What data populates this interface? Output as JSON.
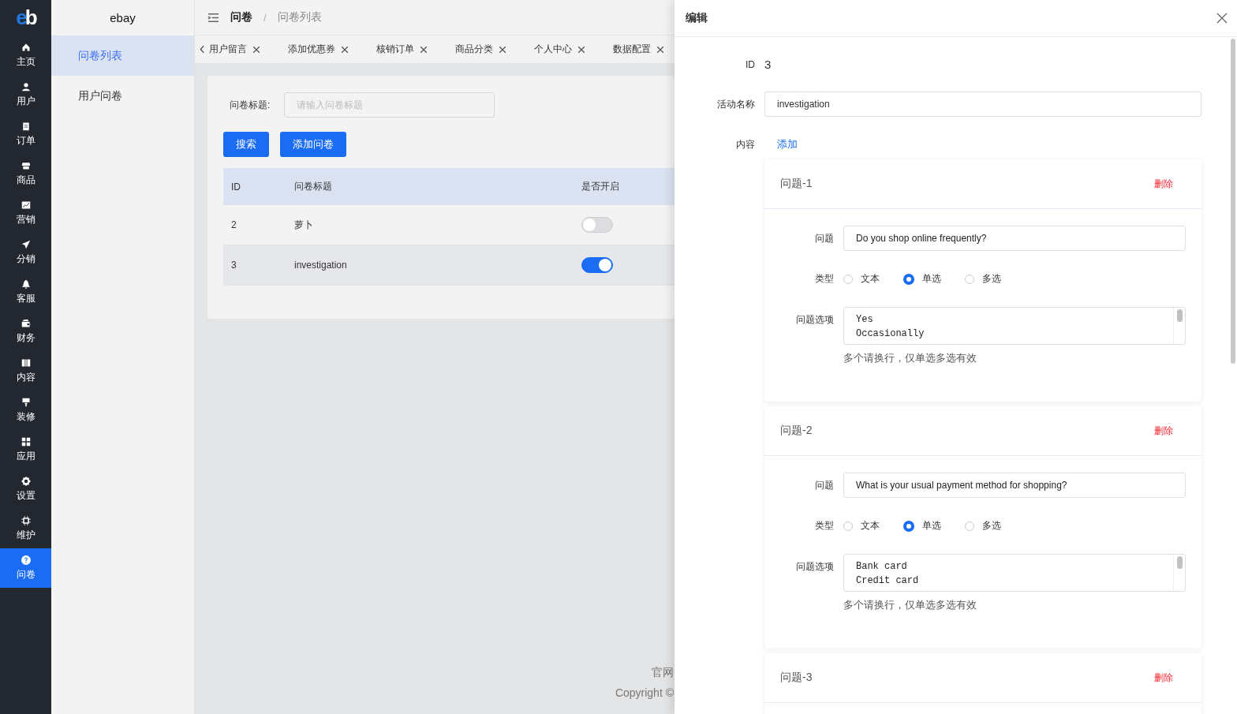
{
  "rail": {
    "logo": "eb",
    "items": [
      {
        "label": "主页",
        "kind": "home",
        "selected": false
      },
      {
        "label": "用户",
        "kind": "user",
        "selected": false
      },
      {
        "label": "订单",
        "kind": "clipboard",
        "selected": false
      },
      {
        "label": "商品",
        "kind": "shop",
        "selected": false
      },
      {
        "label": "营销",
        "kind": "chart",
        "selected": false
      },
      {
        "label": "分销",
        "kind": "plane",
        "selected": false
      },
      {
        "label": "客服",
        "kind": "bell",
        "selected": false
      },
      {
        "label": "财务",
        "kind": "wallet",
        "selected": false
      },
      {
        "label": "内容",
        "kind": "book",
        "selected": false
      },
      {
        "label": "装修",
        "kind": "brush",
        "selected": false
      },
      {
        "label": "应用",
        "kind": "grid",
        "selected": false
      },
      {
        "label": "设置",
        "kind": "gear",
        "selected": false
      },
      {
        "label": "维护",
        "kind": "chip",
        "selected": false
      },
      {
        "label": "问卷",
        "kind": "question",
        "selected": true
      }
    ]
  },
  "submenu": {
    "title": "ebay",
    "items": [
      {
        "label": "问卷列表",
        "selected": true
      },
      {
        "label": "用户问卷",
        "selected": false
      }
    ]
  },
  "breadcrumb": {
    "items": [
      "问卷",
      "问卷列表"
    ],
    "separator": "/"
  },
  "tabs": [
    {
      "label": "用户留言"
    },
    {
      "label": "添加优惠券"
    },
    {
      "label": "核销订单"
    },
    {
      "label": "商品分类"
    },
    {
      "label": "个人中心"
    },
    {
      "label": "数据配置"
    }
  ],
  "search": {
    "label": "问卷标题:",
    "placeholder": "请输入问卷标题"
  },
  "buttons": [
    "搜索",
    "添加问卷"
  ],
  "table": {
    "columns": [
      "ID",
      "问卷标题",
      "是否开启"
    ],
    "rows": [
      {
        "id": "2",
        "title": "萝卜",
        "enabled": false,
        "highlighted": false
      },
      {
        "id": "3",
        "title": "investigation",
        "enabled": true,
        "highlighted": true
      }
    ]
  },
  "footer": [
    "官网",
    "Copyright ©"
  ],
  "drawer": {
    "title": "编辑",
    "fields": [
      {
        "kind": "text",
        "label": "ID",
        "value": "3"
      },
      {
        "kind": "input",
        "label": "活动名称",
        "value": "investigation"
      },
      {
        "kind": "link",
        "label": "内容",
        "value": "添加"
      }
    ],
    "questions": [
      {
        "title": "问题-1",
        "delete": "删除",
        "question_label": "问题",
        "question": "Do you shop online frequently?",
        "type_label": "类型",
        "types": [
          {
            "label": "文本",
            "selected": false
          },
          {
            "label": "单选",
            "selected": true
          },
          {
            "label": "多选",
            "selected": false
          }
        ],
        "options_label": "问题选项",
        "options": "Yes\nOccasionally",
        "hint": "多个请换行，仅单选多选有效"
      },
      {
        "title": "问题-2",
        "delete": "删除",
        "question_label": "问题",
        "question": "What is your usual payment method for shopping?",
        "type_label": "类型",
        "types": [
          {
            "label": "文本",
            "selected": false
          },
          {
            "label": "单选",
            "selected": true
          },
          {
            "label": "多选",
            "selected": false
          }
        ],
        "options_label": "问题选项",
        "options": "Bank card\nCredit card",
        "hint": "多个请换行，仅单选多选有效"
      },
      {
        "title": "问题-3",
        "delete": "删除"
      }
    ]
  }
}
